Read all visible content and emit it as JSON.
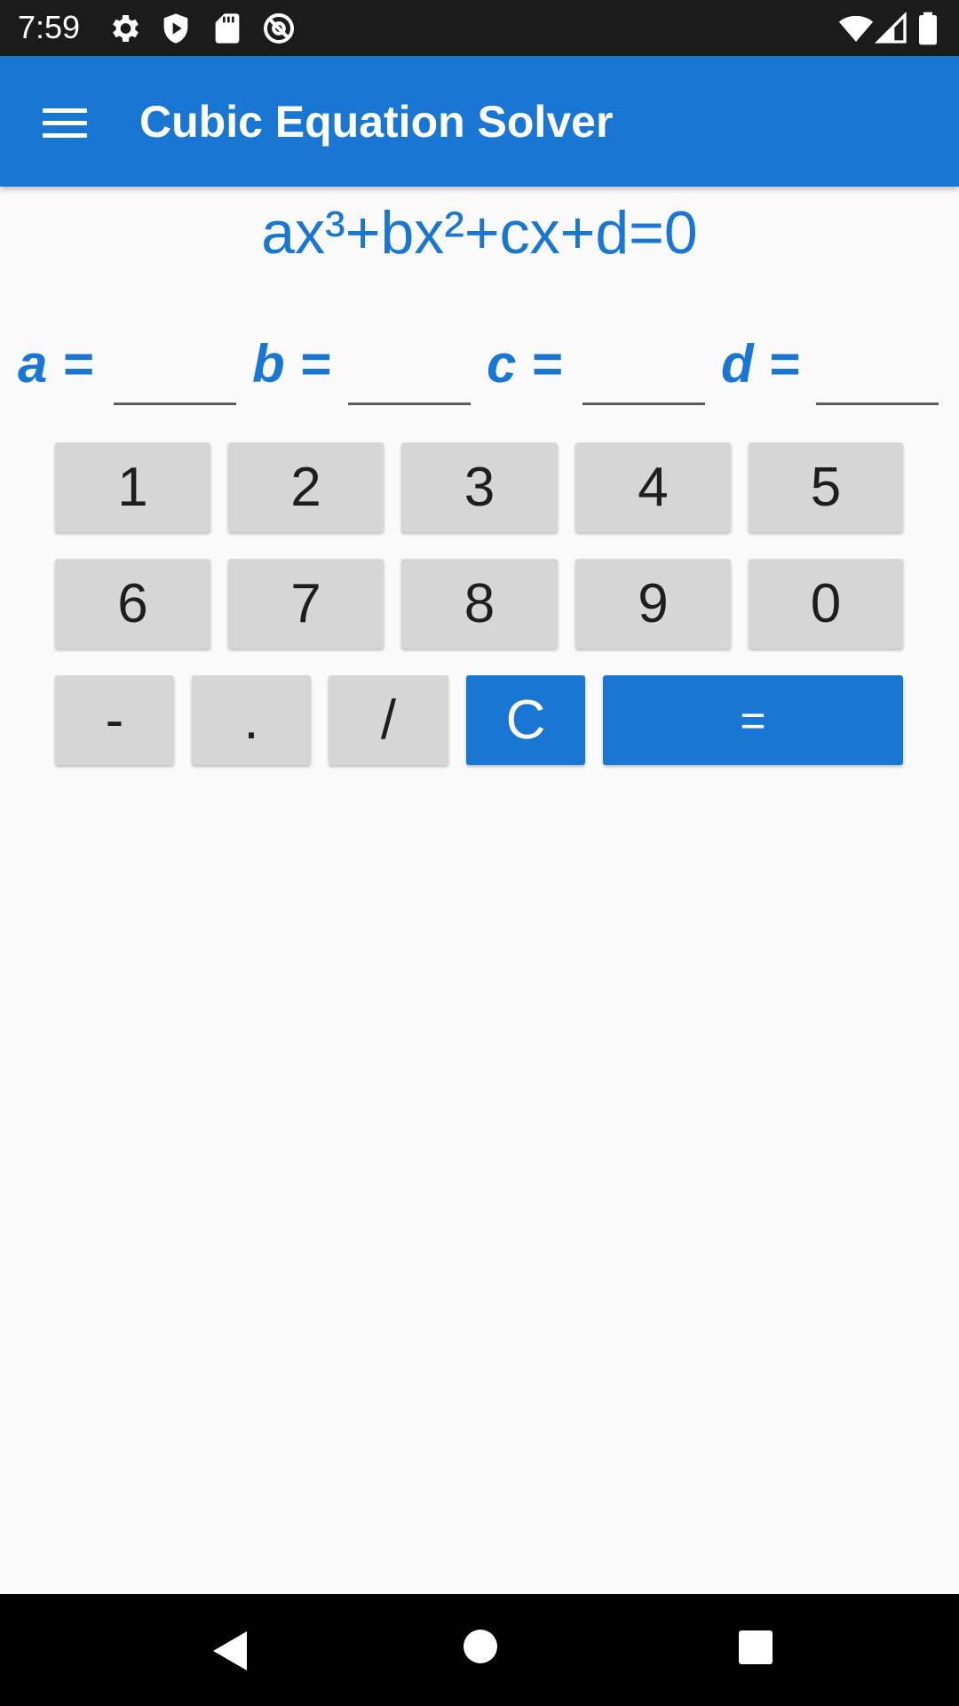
{
  "status_bar": {
    "time": "7:59",
    "left_icons": [
      "gear-icon",
      "shield-play-icon",
      "sd-card-icon",
      "no-location-icon"
    ],
    "right_icons": [
      "wifi-icon",
      "cell-signal-icon",
      "battery-icon"
    ]
  },
  "app_bar": {
    "title": "Cubic Equation Solver",
    "menu_icon": "hamburger-menu-icon"
  },
  "equation": "ax³+bx²+cx+d=0",
  "coefficients": [
    {
      "label": "a =",
      "value": ""
    },
    {
      "label": "b =",
      "value": ""
    },
    {
      "label": "c =",
      "value": ""
    },
    {
      "label": "d =",
      "value": ""
    }
  ],
  "keypad": {
    "row1": [
      "1",
      "2",
      "3",
      "4",
      "5"
    ],
    "row2": [
      "6",
      "7",
      "8",
      "9",
      "0"
    ],
    "row3": [
      "-",
      ".",
      "/",
      "C",
      "="
    ]
  },
  "colors": {
    "primary": "#1976d2",
    "key_background": "#d6d6d6",
    "status_bar": "#1b1b1b"
  },
  "nav_bar": {
    "icons": [
      "back-icon",
      "home-icon",
      "recents-icon"
    ]
  }
}
